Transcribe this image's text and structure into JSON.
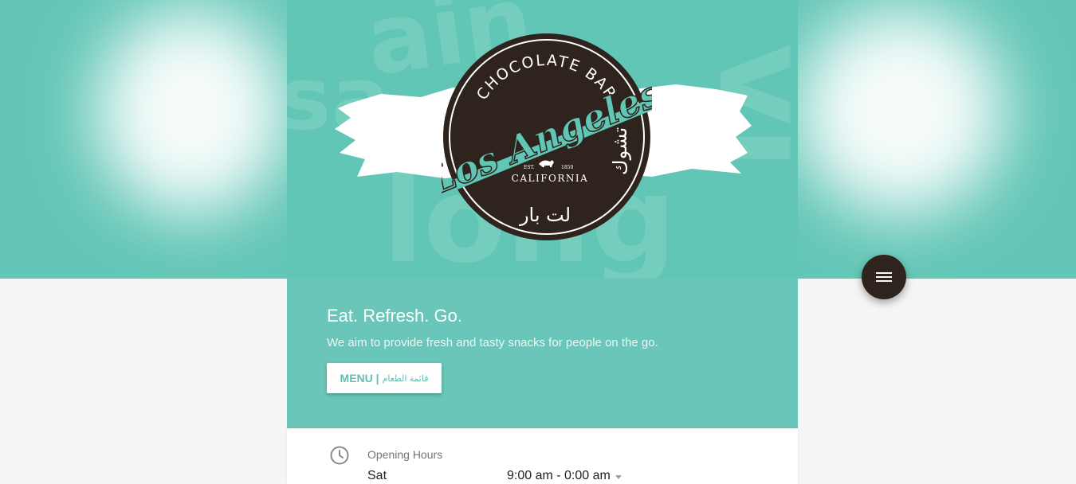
{
  "colors": {
    "teal": "#62c6b6",
    "teal_light": "#6ac6b8",
    "dark_brown": "#2f231d",
    "white": "#ffffff"
  },
  "logo": {
    "top_text": "CHOCOLATE BAR",
    "script_text": "Los Angeles",
    "est_left": "EST.",
    "est_right": "1850",
    "state": "CALIFORNIA",
    "arabic_side": "تشوك",
    "arabic_bottom": "لت بار"
  },
  "hero": {
    "tagline": "Eat. Refresh. Go.",
    "description": "We aim to provide fresh and tasty snacks for people on the go.",
    "menu_button": {
      "label": "MENU |",
      "arabic": "قائمة الطعام"
    }
  },
  "hours": {
    "icon": "clock-icon",
    "title": "Opening Hours",
    "day": "Sat",
    "time": "9:00 am - 0:00 am"
  },
  "fab": {
    "icon": "hamburger-menu-icon"
  }
}
